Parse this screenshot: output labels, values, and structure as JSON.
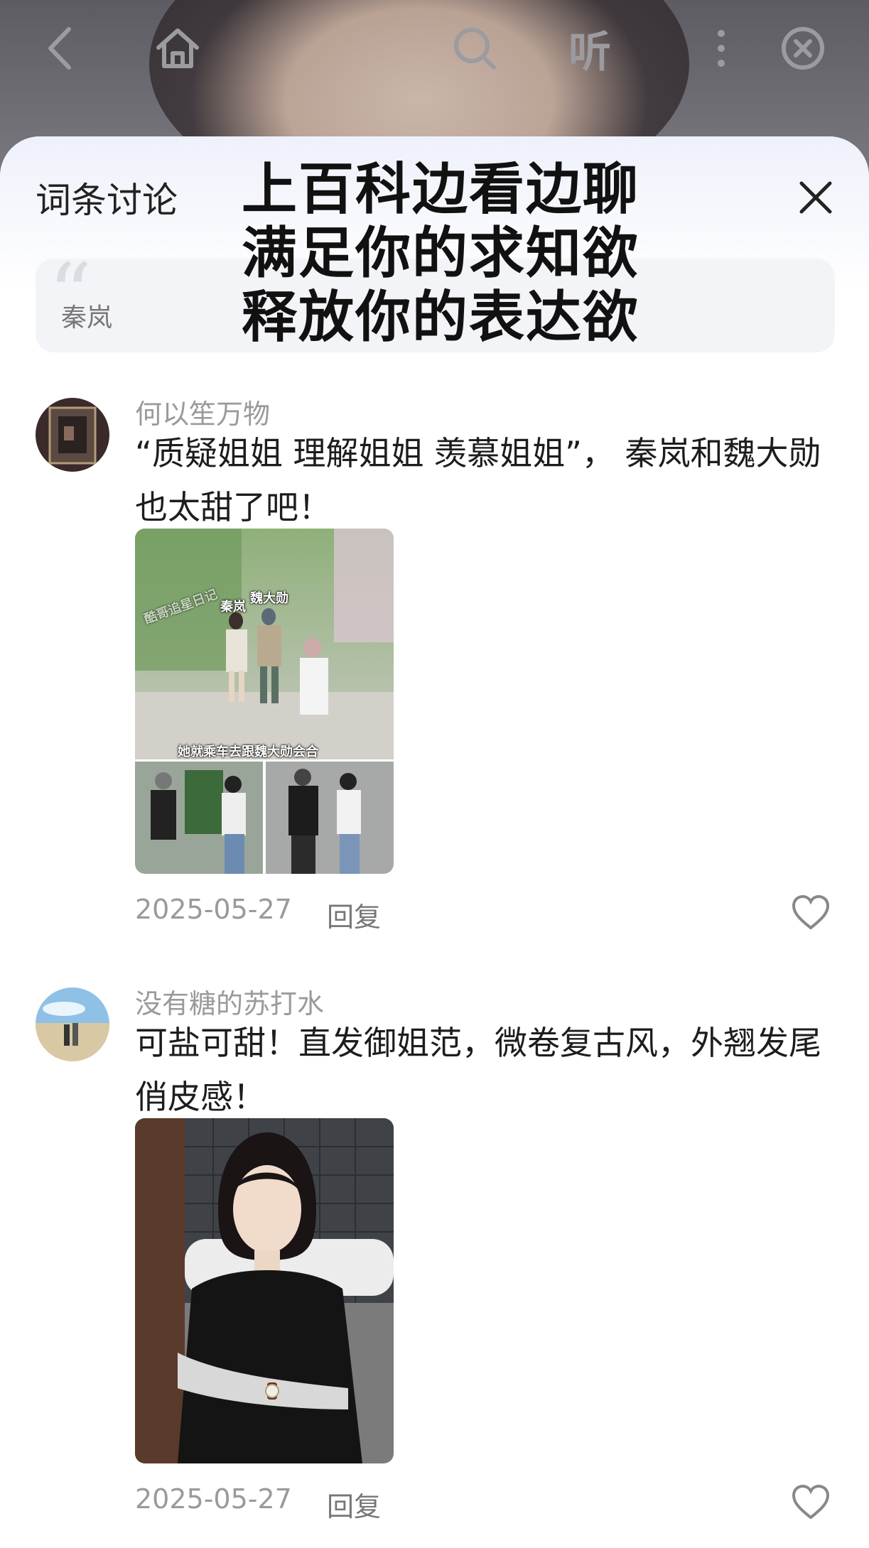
{
  "topbar": {
    "icons": [
      "back-arrow-icon",
      "home-icon",
      "search-icon",
      "listen-button",
      "more-dots-icon",
      "close-circle-icon"
    ],
    "listen_label": "听"
  },
  "sheet": {
    "title": "词条讨论",
    "quoted_entry": "秦岚"
  },
  "overlay_caption": {
    "line1": "上百科边看边聊",
    "line2": "满足你的求知欲",
    "line3": "释放你的表达欲"
  },
  "comments": [
    {
      "username": "何以笙万物",
      "text": "“质疑姐姐 理解姐姐 羡慕姐姐”， 秦岚和魏大勋也太甜了吧！",
      "image_tags": {
        "name_a": "秦岚",
        "name_b": "魏大勋",
        "watermark": "酷哥追星日记",
        "caption": "她就乘车去跟魏大勋会合"
      },
      "date": "2025-05-27",
      "reply_label": "回复"
    },
    {
      "username": "没有糖的苏打水",
      "text": "可盐可甜！直发御姐范，微卷复古风，外翘发尾俏皮感！",
      "date": "2025-05-27",
      "reply_label": "回复"
    }
  ],
  "colors": {
    "sheet_bg": "#ffffff",
    "text_primary": "#1d1d1d",
    "text_secondary": "#9a9a9a",
    "quote_bg": "#f3f4f7"
  }
}
